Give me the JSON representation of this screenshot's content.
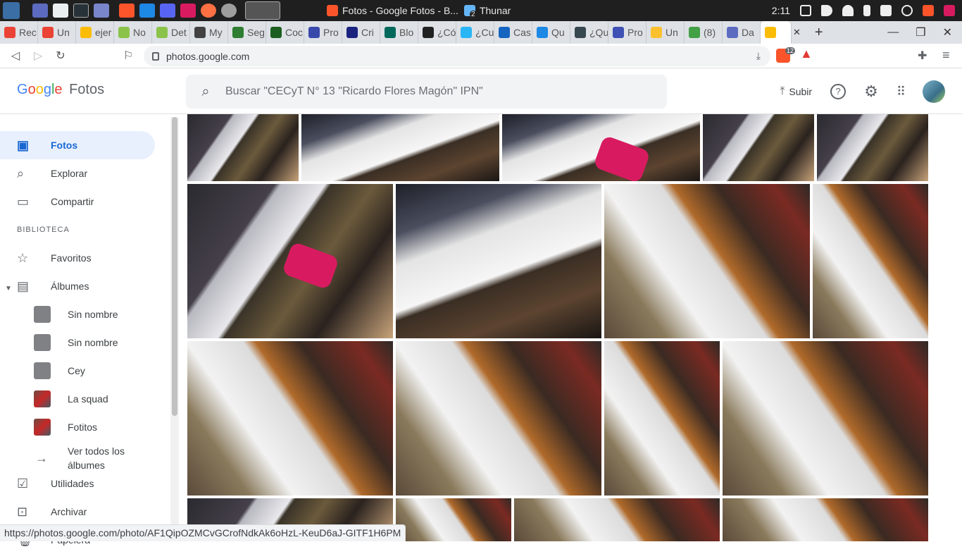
{
  "os": {
    "taskbar": {
      "active_task": "Fotos - Google Fotos - B...",
      "other_task": "Thunar",
      "other_task_badge": "2",
      "clock": "2:11"
    }
  },
  "browser": {
    "tabs": [
      {
        "label": "Rec",
        "favicon_color": "#ea4335"
      },
      {
        "label": "Un",
        "favicon_color": "#ea4335"
      },
      {
        "label": "ejer",
        "favicon_color": "#fbbc05"
      },
      {
        "label": "No",
        "favicon_color": "#8bc34a"
      },
      {
        "label": "Det",
        "favicon_color": "#8bc34a"
      },
      {
        "label": "My",
        "favicon_color": "#424242"
      },
      {
        "label": "Seg",
        "favicon_color": "#2e7d32"
      },
      {
        "label": "Coc",
        "favicon_color": "#1b5e20"
      },
      {
        "label": "Pro",
        "favicon_color": "#3949ab"
      },
      {
        "label": "Cri",
        "favicon_color": "#1a237e"
      },
      {
        "label": "Blo",
        "favicon_color": "#00695c"
      },
      {
        "label": "¿Có",
        "favicon_color": "#212121"
      },
      {
        "label": "¿Cu",
        "favicon_color": "#29b6f6"
      },
      {
        "label": "Cas",
        "favicon_color": "#1565c0"
      },
      {
        "label": "Qu",
        "favicon_color": "#1e88e5"
      },
      {
        "label": "¿Qu",
        "favicon_color": "#37474f"
      },
      {
        "label": "Pro",
        "favicon_color": "#3f51b5"
      },
      {
        "label": "Un",
        "favicon_color": "#fbc02d"
      },
      {
        "label": "(8)",
        "favicon_color": "#43a047"
      },
      {
        "label": "Da",
        "favicon_color": "#5c6bc0"
      },
      {
        "label": "",
        "favicon_color": "#fbbc05",
        "active": true
      }
    ],
    "new_tab_symbol": "+",
    "close_symbol": "✕",
    "window_controls": [
      "—",
      "❐",
      "✕"
    ],
    "url": "photos.google.com",
    "brave_badge": "12"
  },
  "header": {
    "logo_letters": [
      "G",
      "o",
      "o",
      "g",
      "l",
      "e"
    ],
    "product": "Fotos",
    "search_placeholder": "Buscar \"CECyT N° 13 \"Ricardo Flores Magón\" IPN\"",
    "upload_label": "Subir"
  },
  "sidebar": {
    "items": [
      {
        "label": "Fotos",
        "icon": "photo-icon",
        "glyph": "▣",
        "active": true
      },
      {
        "label": "Explorar",
        "icon": "search-icon",
        "glyph": "⌕"
      },
      {
        "label": "Compartir",
        "icon": "share-chat-icon",
        "glyph": "▭"
      }
    ],
    "section_label": "BIBLIOTECA",
    "library": [
      {
        "label": "Favoritos",
        "icon": "star-icon",
        "glyph": "☆"
      },
      {
        "label": "Álbumes",
        "icon": "album-icon",
        "glyph": "▤"
      }
    ],
    "albums": [
      {
        "label": "Sin nombre",
        "has_image": false
      },
      {
        "label": "Sin nombre",
        "has_image": false
      },
      {
        "label": "Cey",
        "has_image": false
      },
      {
        "label": "La squad",
        "has_image": true
      },
      {
        "label": "Fotitos",
        "has_image": true
      }
    ],
    "see_all": "Ver todos los álbumes",
    "bottom": [
      {
        "label": "Utilidades",
        "icon": "utilities-icon",
        "glyph": "☑"
      },
      {
        "label": "Archivar",
        "icon": "archive-icon",
        "glyph": "⊡"
      },
      {
        "label": "Papelera",
        "icon": "trash-icon",
        "glyph": "🗑"
      }
    ]
  },
  "status_url": "https://photos.google.com/photo/AF1QipOZMCvGCrofNdkAk6oHzL-KeuD6aJ-GITF1H6PM"
}
